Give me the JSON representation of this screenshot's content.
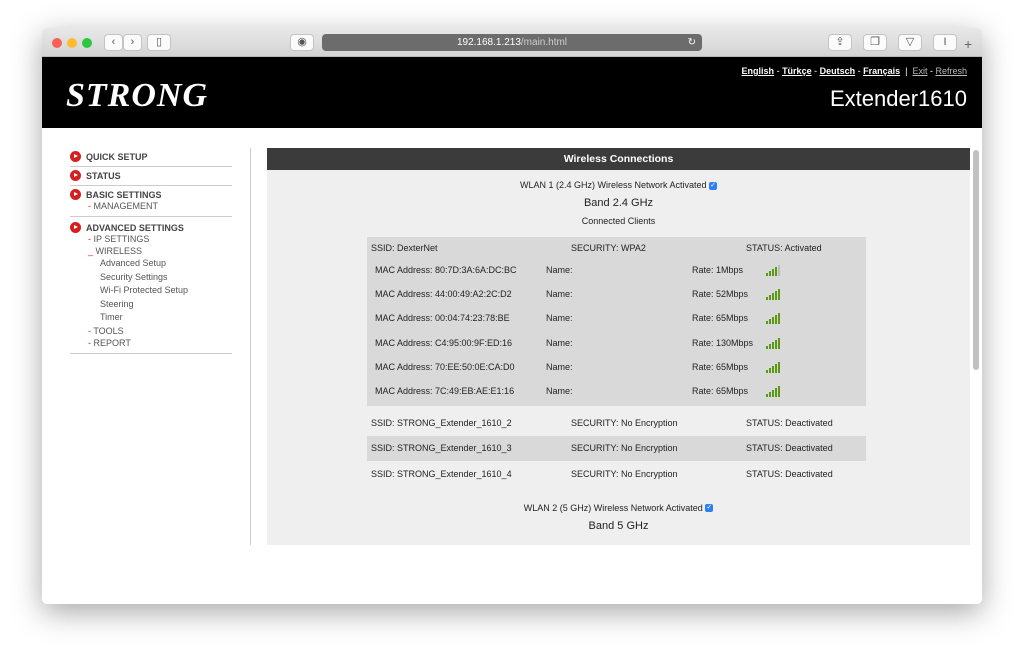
{
  "browser": {
    "url_host": "192.168.1.213",
    "url_path": "/main.html"
  },
  "header": {
    "logo": "STRONG",
    "model": "Extender1610",
    "languages": [
      "English",
      "Türkçe",
      "Deutsch",
      "Français"
    ],
    "exit": "Exit",
    "refresh": "Refresh"
  },
  "sidebar": {
    "quick_setup": "QUICK SETUP",
    "status": "STATUS",
    "basic": "BASIC SETTINGS",
    "management": "MANAGEMENT",
    "advanced": "ADVANCED SETTINGS",
    "ip": "IP SETTINGS",
    "wireless": "WIRELESS",
    "wireless_items": [
      "Advanced Setup",
      "Security Settings",
      "Wi-Fi Protected Setup",
      "Steering",
      "Timer"
    ],
    "tools": "TOOLS",
    "report": "REPORT"
  },
  "main": {
    "title": "Wireless Connections",
    "wlan1": "WLAN 1 (2.4 GHz) Wireless Network Activated",
    "band1": "Band 2.4 GHz",
    "connected": "Connected Clients",
    "ssid1": {
      "ssid": "SSID: DexterNet",
      "security": "SECURITY: WPA2",
      "status": "STATUS: Activated"
    },
    "clients": [
      {
        "mac": "MAC Address: 80:7D:3A:6A:DC:BC",
        "name": "Name:",
        "rate": "Rate: 1Mbps",
        "signal": 4
      },
      {
        "mac": "MAC Address: 44:00:49:A2:2C:D2",
        "name": "Name:",
        "rate": "Rate: 52Mbps",
        "signal": 5
      },
      {
        "mac": "MAC Address: 00:04:74:23:78:BE",
        "name": "Name:",
        "rate": "Rate: 65Mbps",
        "signal": 5
      },
      {
        "mac": "MAC Address: C4:95:00:9F:ED:16",
        "name": "Name:",
        "rate": "Rate: 130Mbps",
        "signal": 5
      },
      {
        "mac": "MAC Address: 70:EE:50:0E:CA:D0",
        "name": "Name:",
        "rate": "Rate: 65Mbps",
        "signal": 5
      },
      {
        "mac": "MAC Address: 7C:49:EB:AE:E1:16",
        "name": "Name:",
        "rate": "Rate: 65Mbps",
        "signal": 5
      }
    ],
    "other_ssids": [
      {
        "ssid": "SSID: STRONG_Extender_1610_2",
        "security": "SECURITY: No Encryption",
        "status": "STATUS: Deactivated"
      },
      {
        "ssid": "SSID: STRONG_Extender_1610_3",
        "security": "SECURITY: No Encryption",
        "status": "STATUS: Deactivated"
      },
      {
        "ssid": "SSID: STRONG_Extender_1610_4",
        "security": "SECURITY: No Encryption",
        "status": "STATUS: Deactivated"
      }
    ],
    "wlan2": "WLAN 2 (5 GHz) Wireless Network Activated",
    "band2": "Band 5 GHz"
  }
}
